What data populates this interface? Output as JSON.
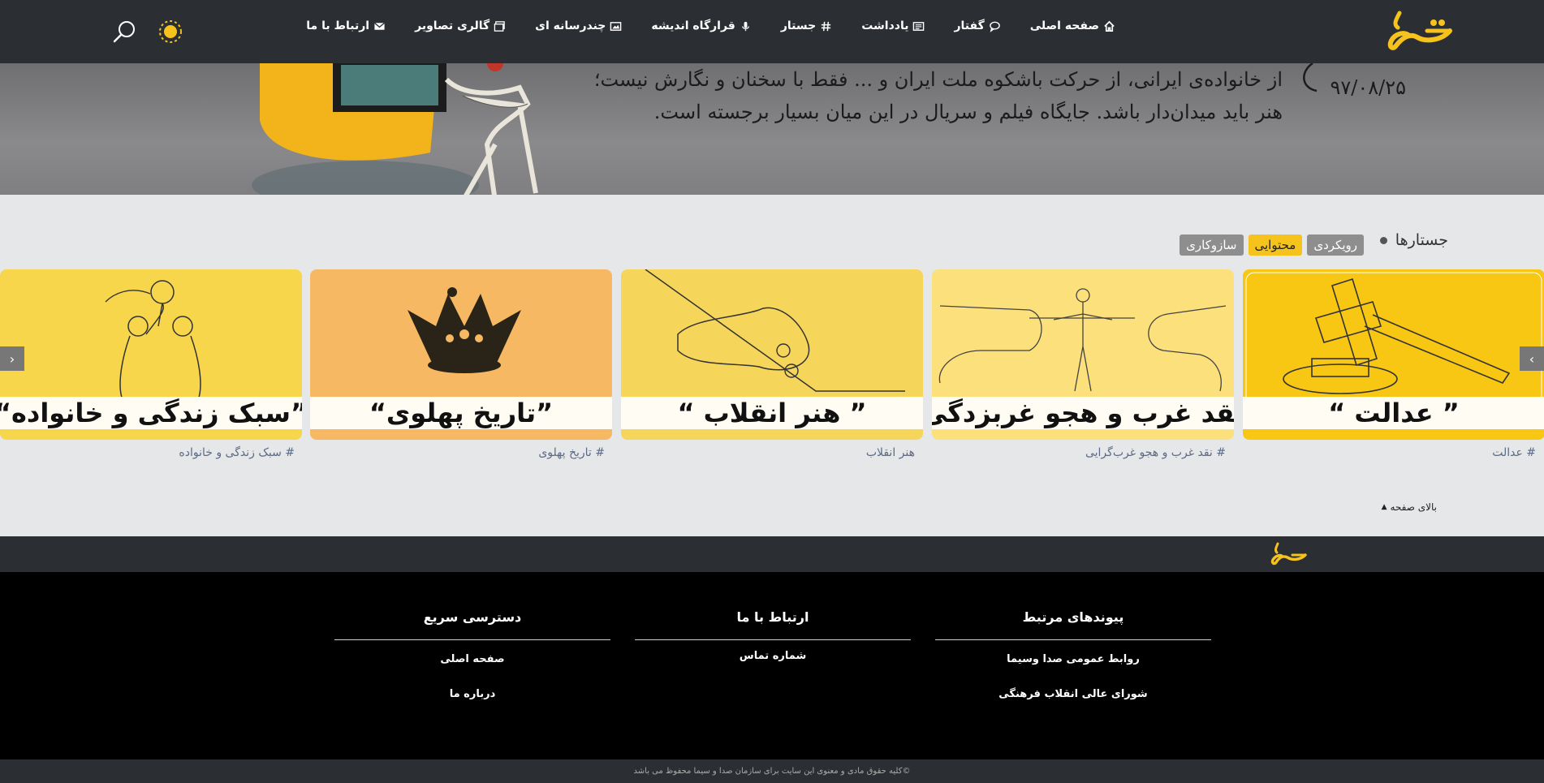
{
  "nav": {
    "items": [
      {
        "label": "صفحه اصلی",
        "icon": "home-icon"
      },
      {
        "label": "گفتار",
        "icon": "chat-icon"
      },
      {
        "label": "یادداشت",
        "icon": "newspaper-icon"
      },
      {
        "label": "جستار",
        "icon": "hashtag-icon"
      },
      {
        "label": "قرارگاه اندیشه",
        "icon": "microphone-icon"
      },
      {
        "label": "چندرسانه ای",
        "icon": "media-icon"
      },
      {
        "label": "گالری تصاویر",
        "icon": "gallery-icon"
      },
      {
        "label": "ارتباط با ما",
        "icon": "envelope-icon"
      }
    ]
  },
  "hero": {
    "line1": "از خانواده‌ی ایرانی، از حرکت باشکوه ملت ایران و ... فقط با سخنان و نگارش نیست؛",
    "line2": "هنر باید میدان‌دار باشد. جایگاه فیلم و سریال در این میان بسیار برجسته است.",
    "date": "۹۷/۰۸/۲۵"
  },
  "section": {
    "title": "جستارها",
    "chips": [
      {
        "label": "رویکردی",
        "color": "#8e8e8e"
      },
      {
        "label": "محتوایی",
        "color": "#f6c21c"
      },
      {
        "label": "سازوکاری",
        "color": "#8e8e8e"
      }
    ]
  },
  "cards": [
    {
      "title": "” عدالت “",
      "tag": "# عدالت",
      "bg": "#f7c713"
    },
    {
      "title": "” نقد غرب و هجو غربزدگی “",
      "tag": "# نقد غرب و هجو غرب‌گرایی",
      "bg": "#fbe07c"
    },
    {
      "title": "” هنر انقلاب “",
      "tag": "هنر انقلاب",
      "bg": "#f6d65a"
    },
    {
      "title": "”تاریخ پهلوی“",
      "tag": "# تاریخ پهلوی",
      "bg": "#f6b862"
    },
    {
      "title": "”سبک زندگی و خانواده“",
      "tag": "# سبک زندگی و خانواده",
      "bg": "#f7d64b"
    }
  ],
  "to_top": "بالای صفحه",
  "footer": {
    "columns": [
      {
        "title": "پیوندهای مرتبط",
        "links": [
          "روابط عمومی صدا وسیما",
          "شورای عالی انقلاب فرهنگی"
        ]
      },
      {
        "title": "ارتباط با ما",
        "links": [
          "شماره تماس"
        ]
      },
      {
        "title": "دسترسی سریع",
        "links": [
          "صفحه اصلی",
          "درباره ما"
        ]
      }
    ],
    "copyright": "©کلیه حقوق مادی و معنوی این سایت برای سازمان صدا و سیما محفوظ می باشد"
  },
  "colors": {
    "nav_bg": "#2b2e33",
    "accent": "#f6c21c"
  }
}
